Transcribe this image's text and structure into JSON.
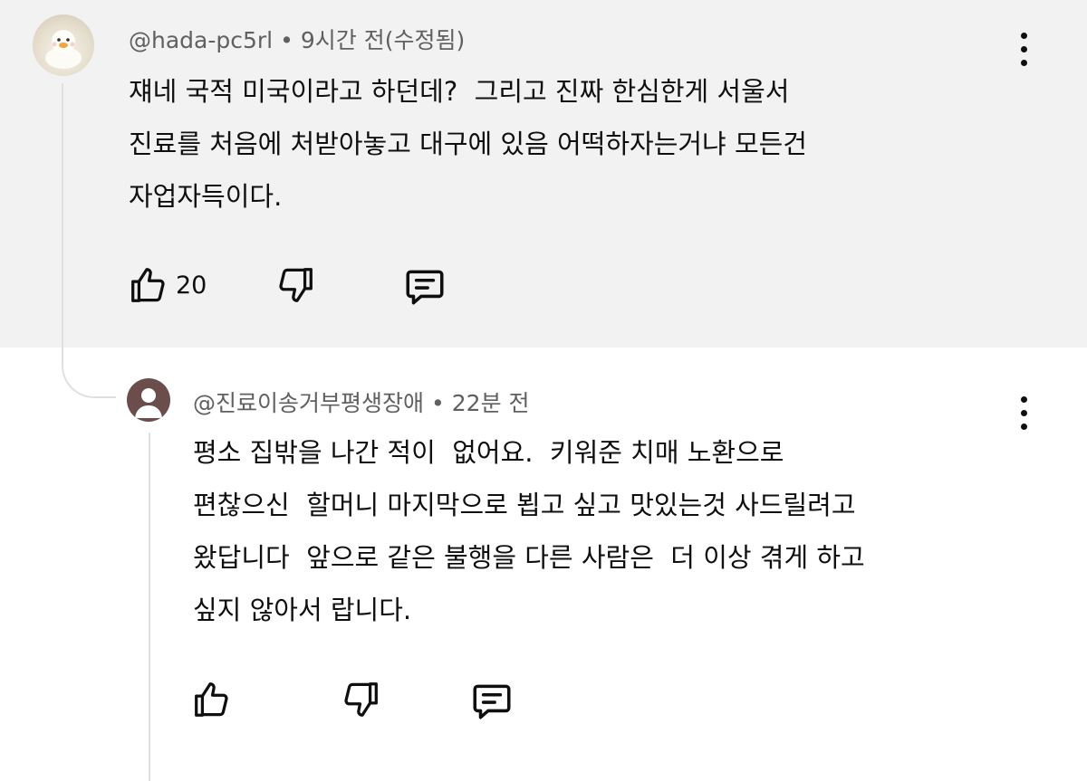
{
  "comment": {
    "handle": "@hada-pc5rl",
    "separator": "•",
    "time": "9시간 전(수정됨)",
    "lines": [
      "쟤네 국적 미국이라고 하던데?  그리고 진짜 한심한게 서울서",
      "진료를 처음에 처받아놓고 대구에 있음 어떡하자는거냐 모든건",
      "자업자득이다."
    ],
    "like_count": "20",
    "icons": {
      "like": "thumbs-up-icon",
      "dislike": "thumbs-down-icon",
      "reply": "reply-icon",
      "menu": "more-vert-icon"
    }
  },
  "reply": {
    "handle": "@진료이송거부평생장애",
    "separator": "•",
    "time": "22분 전",
    "lines": [
      "평소 집밖을 나간 적이  없어요.  키워준 치매 노환으로",
      "편찮으신  할머니 마지막으로 뵙고 싶고 맛있는것 사드릴려고",
      "왔답니다  앞으로 같은 불행을 다른 사람은  더 이상 겪게 하고",
      "싶지 않아서 랍니다."
    ],
    "icons": {
      "like": "thumbs-up-icon",
      "dislike": "thumbs-down-icon",
      "reply": "reply-icon",
      "menu": "more-vert-icon"
    }
  },
  "colors": {
    "highlight_bg": "#f2f2f2",
    "meta_text": "#606060",
    "body_text": "#0f0f0f",
    "thread_line": "#e0e0e0"
  }
}
